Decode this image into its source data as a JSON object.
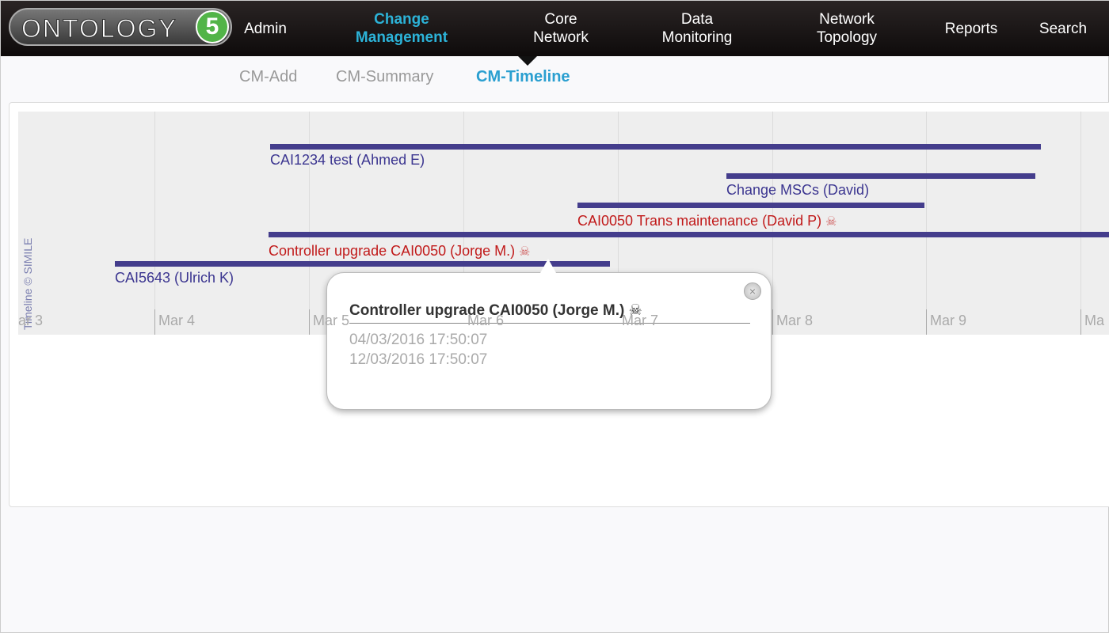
{
  "logo": {
    "text": "ONTOLOGY",
    "badge": "5"
  },
  "nav": {
    "items": [
      {
        "label": "Admin"
      },
      {
        "label": "Change Management",
        "active": true
      },
      {
        "label": "Core Network"
      },
      {
        "label": "Data Monitoring"
      },
      {
        "label": "Network Topology"
      },
      {
        "label": "Reports"
      },
      {
        "label": "Search"
      }
    ]
  },
  "subnav": {
    "items": [
      {
        "label": "CM-Add"
      },
      {
        "label": "CM-Summary"
      },
      {
        "label": "CM-Timeline",
        "active": true
      }
    ]
  },
  "timeline": {
    "credit": "Timeline © SIMILE",
    "ticks": [
      "ar 3",
      "Mar 4",
      "Mar 5",
      "Mar 6",
      "Mar 7",
      "Mar 8",
      "Mar 9",
      "Ma"
    ],
    "events": [
      {
        "label": "CAI1234 test (Ahmed E)",
        "color": "#3b3590"
      },
      {
        "label": "Change MSCs (David)",
        "color": "#3b3590"
      },
      {
        "label": "CAI0050 Trans maintenance (David P)",
        "color": "#c11a1a",
        "icon": "skull-icon"
      },
      {
        "label": "Controller upgrade CAI0050 (Jorge M.)",
        "color": "#c11a1a",
        "icon": "skull-icon"
      },
      {
        "label": "CAI5643 (Ulrich K)",
        "color": "#3b3590"
      }
    ],
    "bar_color": "#443d8c"
  },
  "popup": {
    "title": "Controller upgrade CAI0050 (Jorge M.)",
    "start": "04/03/2016 17:50:07",
    "end": "12/03/2016 17:50:07",
    "close": "×"
  },
  "icons": {
    "skull": "☠"
  }
}
